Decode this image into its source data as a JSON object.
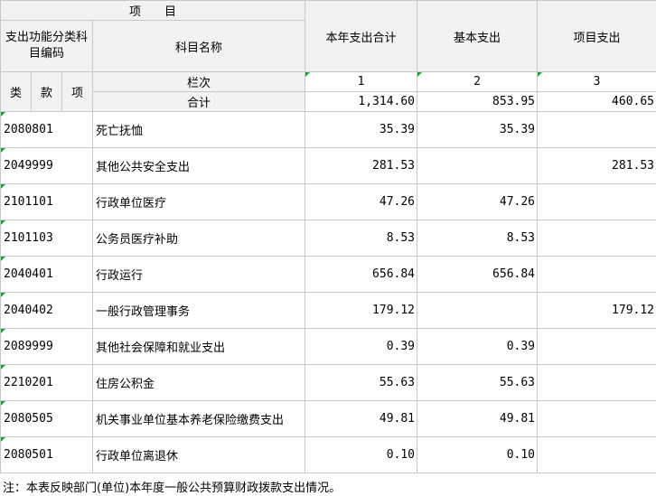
{
  "header": {
    "project": "项　　目",
    "func_code": "支出功能分类科目编码",
    "subject_name": "科目名称",
    "total_col": "本年支出合计",
    "basic_col": "基本支出",
    "project_col": "项目支出",
    "lei": "类",
    "kuan": "款",
    "xiang": "项",
    "lanci": "栏次",
    "col1": "1",
    "col2": "2",
    "col3": "3",
    "heji": "合计"
  },
  "totals": {
    "total": "1,314.60",
    "basic": "853.95",
    "project": "460.65"
  },
  "rows": [
    {
      "code": "2080801",
      "name": "死亡抚恤",
      "total": "35.39",
      "basic": "35.39",
      "project": ""
    },
    {
      "code": "2049999",
      "name": "其他公共安全支出",
      "total": "281.53",
      "basic": "",
      "project": "281.53"
    },
    {
      "code": "2101101",
      "name": "行政单位医疗",
      "total": "47.26",
      "basic": "47.26",
      "project": ""
    },
    {
      "code": "2101103",
      "name": "公务员医疗补助",
      "total": "8.53",
      "basic": "8.53",
      "project": ""
    },
    {
      "code": "2040401",
      "name": "行政运行",
      "total": "656.84",
      "basic": "656.84",
      "project": ""
    },
    {
      "code": "2040402",
      "name": "一般行政管理事务",
      "total": "179.12",
      "basic": "",
      "project": "179.12"
    },
    {
      "code": "2089999",
      "name": "其他社会保障和就业支出",
      "total": "0.39",
      "basic": "0.39",
      "project": ""
    },
    {
      "code": "2210201",
      "name": "住房公积金",
      "total": "55.63",
      "basic": "55.63",
      "project": ""
    },
    {
      "code": "2080505",
      "name": "机关事业单位基本养老保险缴费支出",
      "total": "49.81",
      "basic": "49.81",
      "project": ""
    },
    {
      "code": "2080501",
      "name": "行政单位离退休",
      "total": "0.10",
      "basic": "0.10",
      "project": ""
    }
  ],
  "note": "注：本表反映部门(单位)本年度一般公共预算财政拨款支出情况。",
  "colors": {
    "header_bg": "#f2f2f2",
    "grid": "#c8c8c8",
    "marker": "#1e9c3a"
  }
}
